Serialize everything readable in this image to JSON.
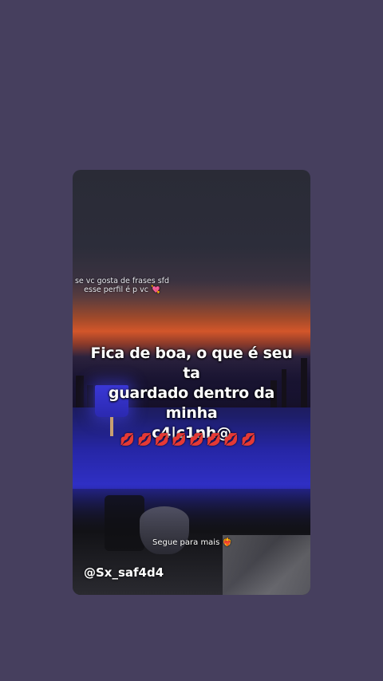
{
  "overlay": {
    "caption_line1": "se vc gosta de frases sfd",
    "caption_line2": "esse perfil é p vc",
    "caption_emoji": "💘",
    "quote_line1": "Fica de boa, o que é seu ta",
    "quote_line2": "guardado dentro da minha",
    "quote_line3": "c4|c1nh@",
    "lips": "💋💋💋💋💋💋💋💋",
    "follow_text": "Segue para mais",
    "follow_emoji": "❤️‍🔥",
    "handle": "@Sx_saf4d4"
  },
  "colors": {
    "background": "#463f5e",
    "sunset": "#d3562a",
    "pool": "#2f2fc4"
  }
}
